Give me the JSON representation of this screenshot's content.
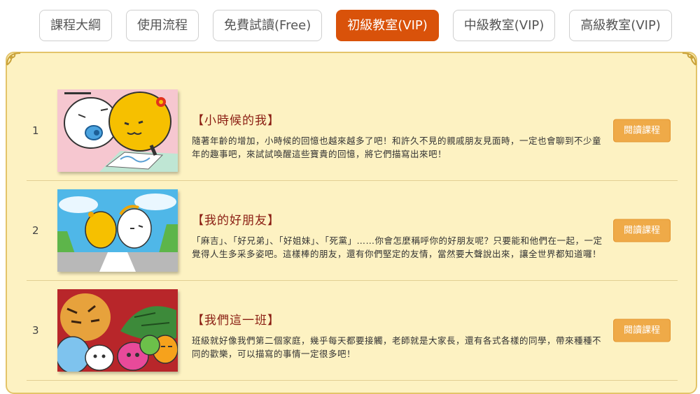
{
  "tabs": [
    {
      "label": "課程大綱"
    },
    {
      "label": "使用流程"
    },
    {
      "label": "免費試讀(Free)"
    },
    {
      "label": "初級教室(VIP)",
      "active": true
    },
    {
      "label": "中級教室(VIP)"
    },
    {
      "label": "高級教室(VIP)"
    }
  ],
  "colors": {
    "active_tab": "#d9520a",
    "panel_bg": "#fdf2c2",
    "panel_border": "#e3c469",
    "button": "#efaa48",
    "title": "#8a1d12"
  },
  "lessons": [
    {
      "number": "1",
      "title": "【小時候的我】",
      "description": "隨著年齡的增加，小時候的回憶也越來越多了吧！和許久不見的親戚朋友見面時，一定也會聊到不少童年的趣事吧，來試試喚醒這些寶貴的回憶，將它們描寫出來吧！",
      "button": "閱讀課程",
      "thumbnail": "two-characters-drawing-icon"
    },
    {
      "number": "2",
      "title": "【我的好朋友】",
      "description": "「麻吉」、「好兄弟」、「好姐妹」、「死黨」……你會怎麼稱呼你的好朋友呢？只要能和他們在一起，一定覺得人生多采多姿吧。這樣棒的朋友，還有你們堅定的友情，當然要大聲說出來，讓全世界都知道囉！",
      "button": "閱讀課程",
      "thumbnail": "two-friends-sky-icon"
    },
    {
      "number": "3",
      "title": "【我們這一班】",
      "description": "班級就好像我們第二個家庭，幾乎每天都要接觸，老師就是大家長，還有各式各樣的同學，帶來種種不同的歡樂，可以描寫的事情一定很多吧！",
      "button": "閱讀課程",
      "thumbnail": "tiger-dragon-class-icon"
    }
  ]
}
